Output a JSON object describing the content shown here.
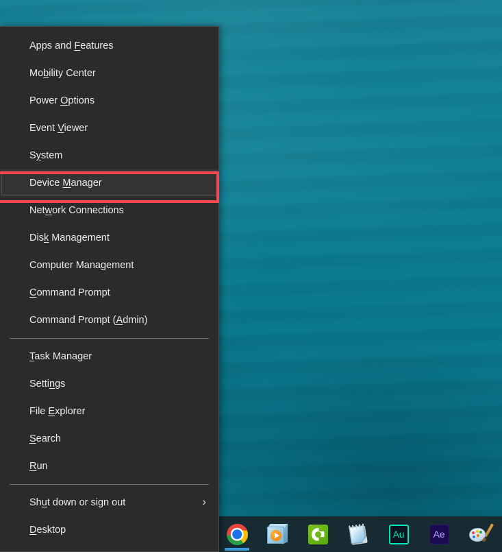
{
  "desktop": {
    "wallpaper_description": "teal underwater water texture",
    "wallpaper_color": "#0b798e"
  },
  "context_menu": {
    "name": "Win+X quick link menu",
    "background_color": "#2b2b2b",
    "text_color": "#ebebeb",
    "groups": [
      {
        "items": [
          {
            "label": "Apps and Features",
            "pre": "Apps and ",
            "accel": "F",
            "post": "eatures",
            "submenu": false
          },
          {
            "label": "Mobility Center",
            "pre": "Mo",
            "accel": "b",
            "post": "ility Center",
            "submenu": false
          },
          {
            "label": "Power Options",
            "pre": "Power ",
            "accel": "O",
            "post": "ptions",
            "submenu": false
          },
          {
            "label": "Event Viewer",
            "pre": "Event ",
            "accel": "V",
            "post": "iewer",
            "submenu": false
          },
          {
            "label": "System",
            "pre": "S",
            "accel": "y",
            "post": "stem",
            "submenu": false
          },
          {
            "label": "Device Manager",
            "pre": "Device ",
            "accel": "M",
            "post": "anager",
            "submenu": false,
            "highlighted": true
          },
          {
            "label": "Network Connections",
            "pre": "Net",
            "accel": "w",
            "post": "ork Connections",
            "submenu": false
          },
          {
            "label": "Disk Management",
            "pre": "Dis",
            "accel": "k",
            "post": " Management",
            "submenu": false
          },
          {
            "label": "Computer Management",
            "pre": "Computer Mana",
            "accel": "g",
            "post": "ement",
            "submenu": false
          },
          {
            "label": "Command Prompt",
            "pre": "",
            "accel": "C",
            "post": "ommand Prompt",
            "submenu": false
          },
          {
            "label": "Command Prompt (Admin)",
            "pre": "Command Prompt (",
            "accel": "A",
            "post": "dmin)",
            "submenu": false
          }
        ]
      },
      {
        "items": [
          {
            "label": "Task Manager",
            "pre": "",
            "accel": "T",
            "post": "ask Manager",
            "submenu": false
          },
          {
            "label": "Settings",
            "pre": "Setti",
            "accel": "n",
            "post": "gs",
            "submenu": false
          },
          {
            "label": "File Explorer",
            "pre": "File ",
            "accel": "E",
            "post": "xplorer",
            "submenu": false
          },
          {
            "label": "Search",
            "pre": "",
            "accel": "S",
            "post": "earch",
            "submenu": false
          },
          {
            "label": "Run",
            "pre": "",
            "accel": "R",
            "post": "un",
            "submenu": false
          }
        ]
      },
      {
        "items": [
          {
            "label": "Shut down or sign out",
            "pre": "Sh",
            "accel": "u",
            "post": "t down or sign out",
            "submenu": true,
            "chevron": "›"
          },
          {
            "label": "Desktop",
            "pre": "",
            "accel": "D",
            "post": "esktop",
            "submenu": false
          }
        ]
      }
    ]
  },
  "annotation": {
    "target_label": "Device Manager",
    "shape": "rectangle",
    "color": "#f8474f",
    "thickness_px": 4
  },
  "taskbar": {
    "background_color": "#182b33",
    "items": [
      {
        "name": "Google Chrome",
        "icon": "chrome-icon",
        "running": true
      },
      {
        "name": "Media Player",
        "icon": "media-box-icon",
        "running": false
      },
      {
        "name": "Camtasia",
        "icon": "camtasia-icon",
        "running": false
      },
      {
        "name": "Notepad",
        "icon": "notepad-icon",
        "running": false
      },
      {
        "name": "Adobe Audition",
        "icon": "audition-icon",
        "label": "Au",
        "running": false
      },
      {
        "name": "Adobe After Effects",
        "icon": "after-effects-icon",
        "label": "Ae",
        "running": false
      },
      {
        "name": "Paint",
        "icon": "paint-icon",
        "running": false
      }
    ]
  }
}
